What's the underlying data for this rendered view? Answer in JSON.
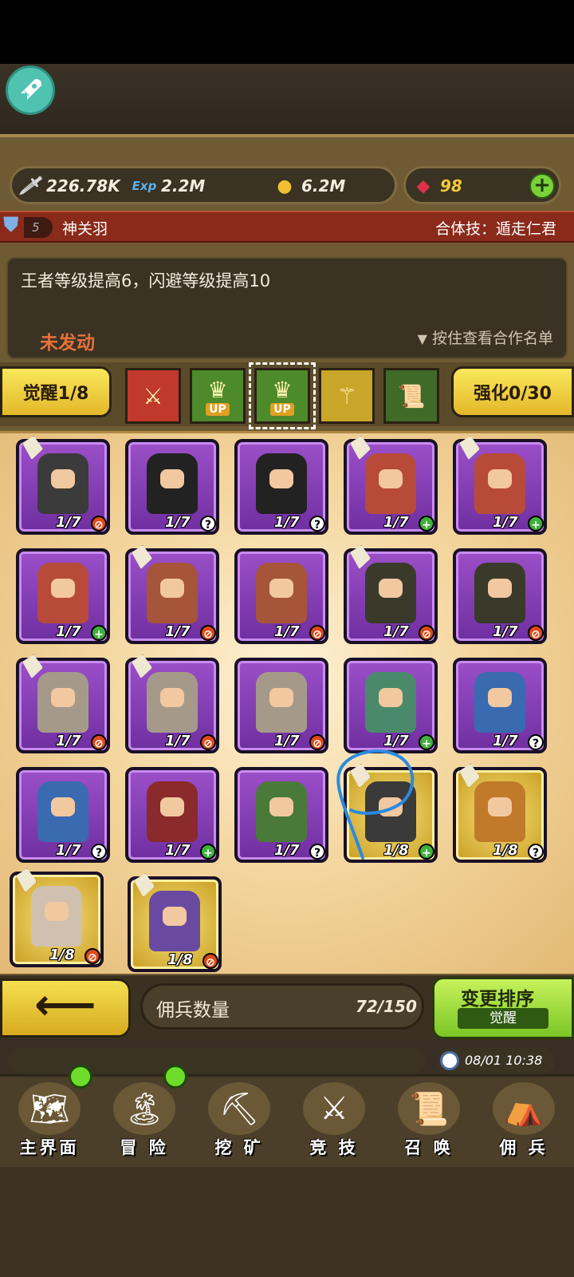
{
  "resources": {
    "attack": "226.78K",
    "exp": "2.2M",
    "gold": "6.2M",
    "gems": "98"
  },
  "synergy": {
    "level": "5",
    "name": "神关羽",
    "combo_skill": "合体技：遁走仁君",
    "description": "王者等级提高6，闪避等级提高10",
    "status": "未发动",
    "hint": "按住查看合作名单"
  },
  "tabs": {
    "awaken": "觉醒1/8",
    "enhance": "强化0/30"
  },
  "skills": [
    {
      "icon": "slash-skill-icon",
      "color": "#c0392b"
    },
    {
      "icon": "crown-up-icon",
      "color": "#4c8a2a",
      "label": "UP"
    },
    {
      "icon": "crown-up-icon",
      "color": "#4c8a2a",
      "label": "UP",
      "selected": true
    },
    {
      "icon": "glaive-icon",
      "color": "#c9a52a"
    },
    {
      "icon": "scroll-icon",
      "color": "#3f6a28"
    }
  ],
  "heroes": [
    {
      "frame": "purple",
      "level": "1/7",
      "stat": "no",
      "tag": true,
      "color": "#3b3b3b"
    },
    {
      "frame": "purple",
      "level": "1/7",
      "stat": "q",
      "tag": false,
      "color": "#222"
    },
    {
      "frame": "purple",
      "level": "1/7",
      "stat": "q",
      "tag": false,
      "color": "#222"
    },
    {
      "frame": "purple",
      "level": "1/7",
      "stat": "up",
      "tag": true,
      "color": "#b84a3a"
    },
    {
      "frame": "purple",
      "level": "1/7",
      "stat": "up",
      "tag": true,
      "color": "#b84a3a"
    },
    {
      "frame": "purple",
      "level": "1/7",
      "stat": "up",
      "tag": false,
      "color": "#b84a3a"
    },
    {
      "frame": "purple",
      "level": "1/7",
      "stat": "no",
      "tag": true,
      "color": "#a6543a"
    },
    {
      "frame": "purple",
      "level": "1/7",
      "stat": "no",
      "tag": false,
      "color": "#a6543a"
    },
    {
      "frame": "purple",
      "level": "1/7",
      "stat": "no",
      "tag": true,
      "color": "#3a3a2a"
    },
    {
      "frame": "purple",
      "level": "1/7",
      "stat": "no",
      "tag": false,
      "color": "#3a3a2a"
    },
    {
      "frame": "purple",
      "level": "1/7",
      "stat": "no",
      "tag": true,
      "color": "#a59a8a"
    },
    {
      "frame": "purple",
      "level": "1/7",
      "stat": "no",
      "tag": true,
      "color": "#a59a8a"
    },
    {
      "frame": "purple",
      "level": "1/7",
      "stat": "no",
      "tag": false,
      "color": "#a59a8a"
    },
    {
      "frame": "purple",
      "level": "1/7",
      "stat": "up",
      "tag": false,
      "color": "#4a8a6a"
    },
    {
      "frame": "purple",
      "level": "1/7",
      "stat": "q",
      "tag": false,
      "color": "#3a6ab0"
    },
    {
      "frame": "purple",
      "level": "1/7",
      "stat": "q",
      "tag": false,
      "color": "#3a6ab0"
    },
    {
      "frame": "purple",
      "level": "1/7",
      "stat": "up",
      "tag": false,
      "color": "#8a2a2a"
    },
    {
      "frame": "purple",
      "level": "1/7",
      "stat": "q",
      "tag": false,
      "color": "#4a7a3a"
    },
    {
      "frame": "gold",
      "level": "1/8",
      "stat": "up",
      "tag": true,
      "color": "#3a3a3a"
    },
    {
      "frame": "gold",
      "level": "1/8",
      "stat": "q",
      "tag": true,
      "color": "#c07a2a"
    },
    {
      "frame": "gold",
      "level": "1/8",
      "stat": "no",
      "tag": true,
      "color": "#d0c0b0"
    },
    {
      "frame": "gold",
      "level": "1/8",
      "stat": "no",
      "tag": true,
      "color": "#6a4aa0"
    }
  ],
  "footer": {
    "count_label": "佣兵数量",
    "count_value": "72/150",
    "sort_title": "变更排序",
    "sort_sub": "觉醒",
    "time": "08/01 10:38"
  },
  "nav": [
    {
      "label": "主界面",
      "icon": "map-scroll-icon",
      "dot": true
    },
    {
      "label": "冒 险",
      "icon": "island-icon",
      "dot": true
    },
    {
      "label": "挖 矿",
      "icon": "pickaxe-icon",
      "dot": false
    },
    {
      "label": "竞 技",
      "icon": "crossed-swords-icon",
      "dot": false
    },
    {
      "label": "召 唤",
      "icon": "summon-scroll-icon",
      "dot": false
    },
    {
      "label": "佣 兵",
      "icon": "tent-icon",
      "dot": false
    }
  ]
}
